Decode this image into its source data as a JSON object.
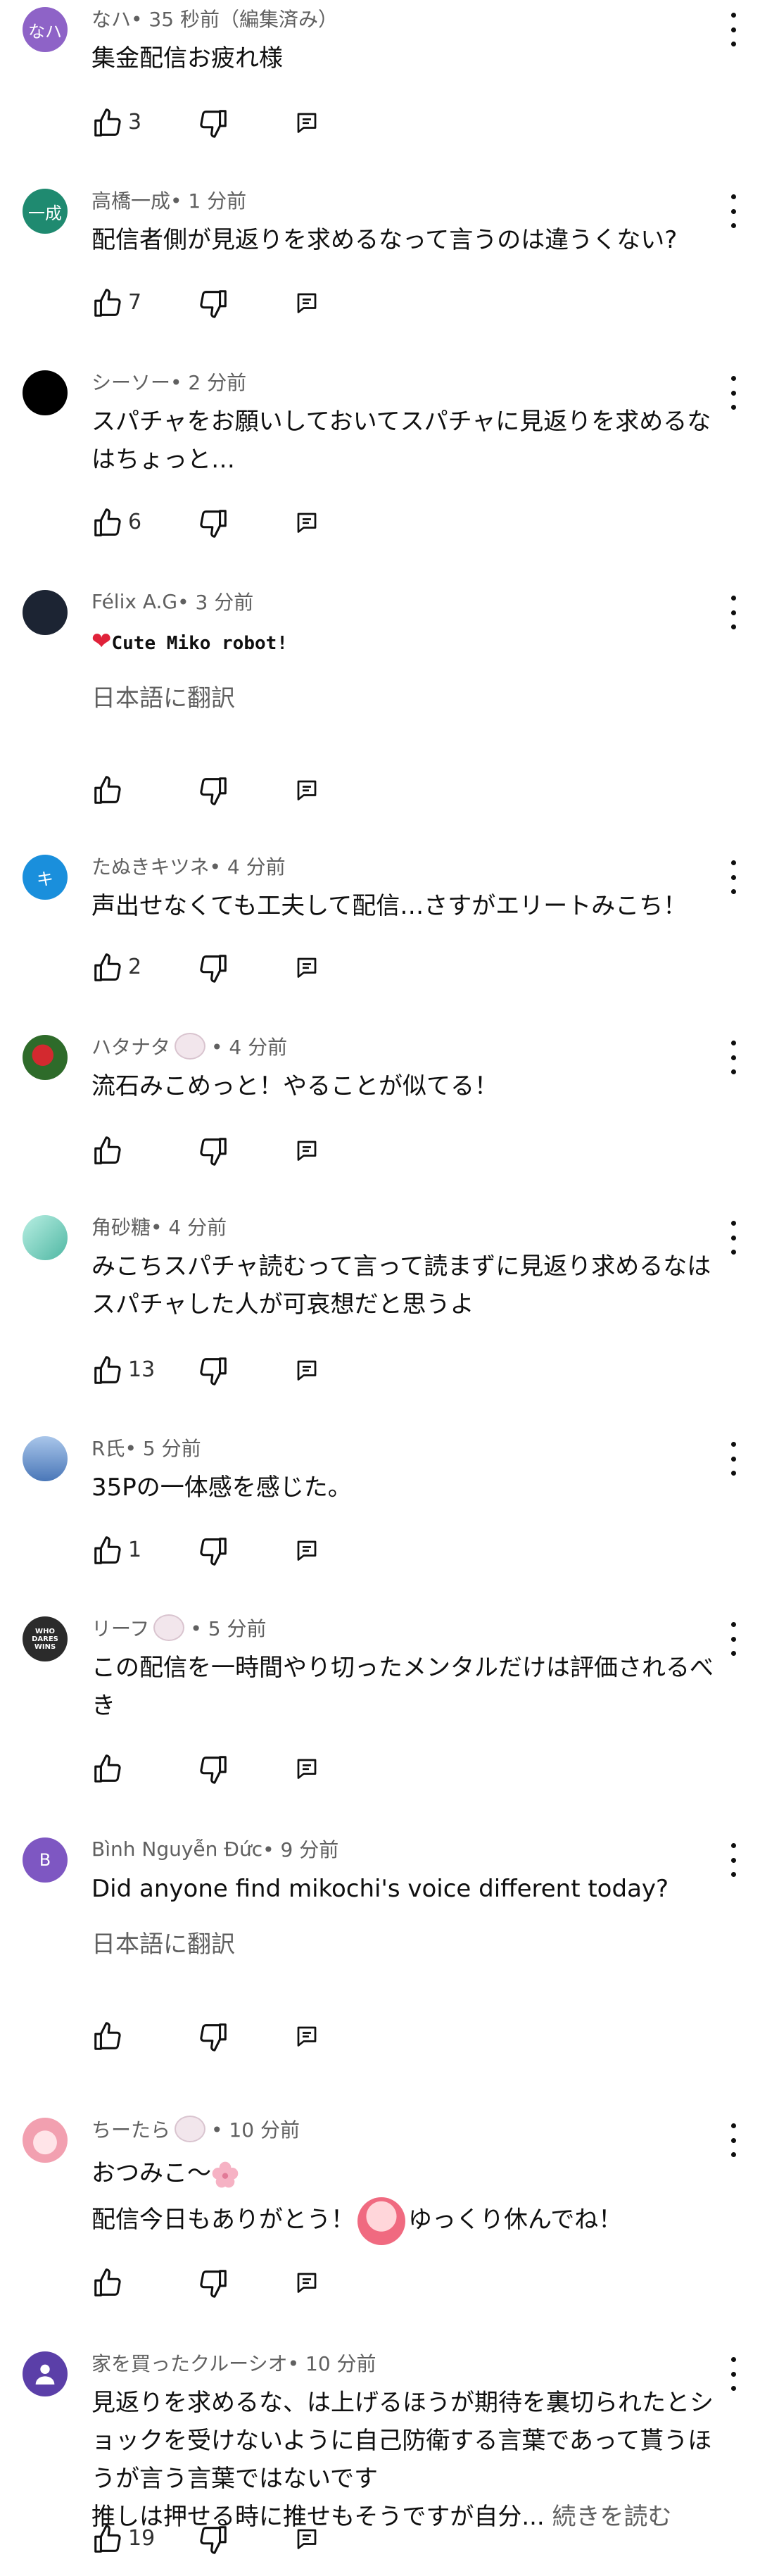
{
  "comments": [
    {
      "author": "なハ",
      "time": " • 35 秒前（編集済み）",
      "avatar_text": "なハ",
      "avatar_color": "#8e63c7",
      "text": "集金配信お疲れ様",
      "likes": "3"
    },
    {
      "author": "高橋一成",
      "time": " • 1 分前",
      "avatar_text": "一成",
      "avatar_color": "#1f8a70",
      "text": "配信者側が見返りを求めるなって言うのは違うくない?",
      "likes": "7"
    },
    {
      "author": "シーソー",
      "time": " • 2 分前",
      "avatar_text": "",
      "avatar_color": "#000000",
      "text": "スパチャをお願いしておいてスパチャに見返りを求めるなはちょっと…",
      "likes": "6"
    },
    {
      "author": "Félix A.G",
      "time": " • 3 分前",
      "avatar_text": "",
      "avatar_color": "#1c2433",
      "text_prefix": "❤",
      "text": "Cute Miko robot!",
      "translate": "日本語に翻訳",
      "likes": ""
    },
    {
      "author": "たぬきキツネ",
      "time": " • 4 分前",
      "avatar_text": "キ",
      "avatar_color": "#1a8fdc",
      "text": "声出せなくても工夫して配信…さすがエリートみこち！",
      "likes": "2"
    },
    {
      "author": "ハタナタ",
      "time": " • 4 分前",
      "avatar_text": "",
      "avatar_color": "#2e6b2a",
      "text": "流石みこめっと！やることが似てる！",
      "likes": ""
    },
    {
      "author": "角砂糖",
      "time": " • 4 分前",
      "avatar_text": "",
      "avatar_color": "#4fb7a3",
      "text": "みこちスパチャ読むって言って読まずに見返り求めるなはスパチャした人が可哀想だと思うよ",
      "likes": "13"
    },
    {
      "author": "R氏",
      "time": " • 5 分前",
      "avatar_text": "",
      "avatar_color": "#4a77b8",
      "text": "35Pの一体感を感じた。",
      "likes": "1"
    },
    {
      "author": "リーフ",
      "time": " • 5 分前",
      "avatar_text": "WHO DARES WINS",
      "avatar_color": "#2b2b2b",
      "text": "この配信を一時間やり切ったメンタルだけは評価されるべき",
      "likes": ""
    },
    {
      "author": "Bình Nguyễn Đức",
      "time": " • 9 分前",
      "avatar_text": "B",
      "avatar_color": "#7e57c2",
      "text": "Did anyone find mikochi's voice different today?",
      "translate": "日本語に翻訳",
      "likes": ""
    },
    {
      "author": "ちーたら",
      "time": " • 10 分前",
      "avatar_text": "",
      "avatar_color": "#f2a0b0",
      "text_line1": "おつみこ〜",
      "text_line2a": "配信今日もありがとう！",
      "text_line2b": "ゆっくり休んでね！",
      "likes": ""
    },
    {
      "author": "家を買ったクルーシオ",
      "time": " • 10 分前",
      "avatar_text": "",
      "avatar_color": "#5b3fa8",
      "text": "見返りを求めるな、は上げるほうが期待を裏切られたとショックを受けないように自己防衛する言葉であって貰うほうが言う言葉ではないです\n推しは押せる時に推せもそうですが自分...",
      "more": " 続きを読む",
      "likes": "19"
    }
  ],
  "icons": {
    "like": "thumb-up-icon",
    "dislike": "thumb-down-icon",
    "reply": "reply-icon",
    "menu": "more-vert-icon"
  }
}
